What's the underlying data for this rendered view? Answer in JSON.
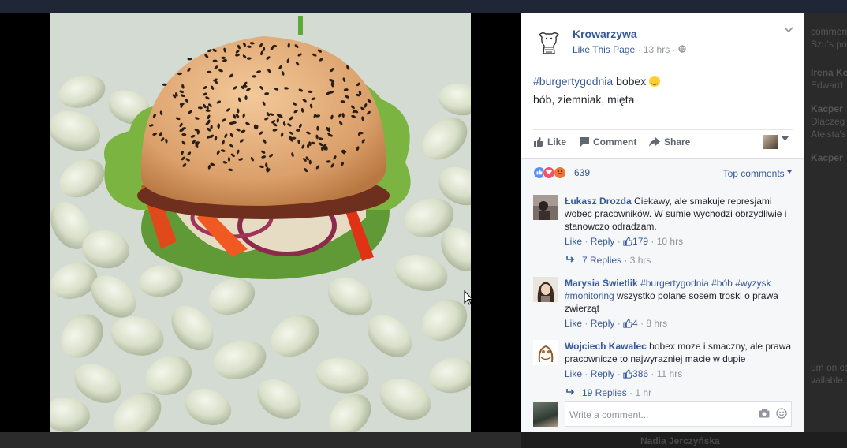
{
  "post": {
    "page_name": "Krowarzywa",
    "like_page": "Like This Page",
    "time": "13 hrs",
    "privacy_sep": "·",
    "hashtag": "#burgertygodnia",
    "title_text": "bobex",
    "line2": "bób, ziemniak, mięta",
    "actions": {
      "like": "Like",
      "comment": "Comment",
      "share": "Share"
    }
  },
  "reactions": {
    "count": "639",
    "sort_label": "Top comments",
    "types": [
      "like-icon",
      "love-icon",
      "angry-icon"
    ],
    "colors": {
      "like": "#5890ff",
      "love": "#f25268",
      "angry": "#f0733a"
    }
  },
  "comments": [
    {
      "author": "Łukasz Drozda",
      "text": "Ciekawy, ale smakuje represjami wobec pracowników. W sumie wychodzi obrzydliwie i stanowczo odradzam.",
      "like": "Like",
      "reply": "Reply",
      "likes": "179",
      "time": "10 hrs",
      "replies": "7 Replies",
      "replies_time": "3 hrs"
    },
    {
      "author": "Marysia Świetlik",
      "tags": "#burgertygodnia #bób #wyzysk #monitoring",
      "text": "wszystko polane sosem troski o prawa zwierząt",
      "like": "Like",
      "reply": "Reply",
      "likes": "4",
      "time": "8 hrs"
    },
    {
      "author": "Wojciech Kawalec",
      "text": "bobex moze i smaczny, ale prawa pracownicze to najwyrazniej macie w dupie",
      "like": "Like",
      "reply": "Reply",
      "likes": "386",
      "time": "11 hrs",
      "replies": "19 Replies",
      "replies_time": "1 hr"
    }
  ],
  "composer": {
    "placeholder": "Write a comment..."
  },
  "background": {
    "right_snippets": [
      "comment",
      "Szu's po",
      "Irena Ko",
      "Edward",
      "Kacper",
      "Dlaczeg",
      "Ateista's",
      "Kacper",
      "um on ca",
      "vailable."
    ],
    "bottom_name": "Nadia Jerczyńska"
  },
  "colors": {
    "link": "#365899",
    "muted": "#90949c",
    "panel_bg": "#f6f7f9"
  }
}
